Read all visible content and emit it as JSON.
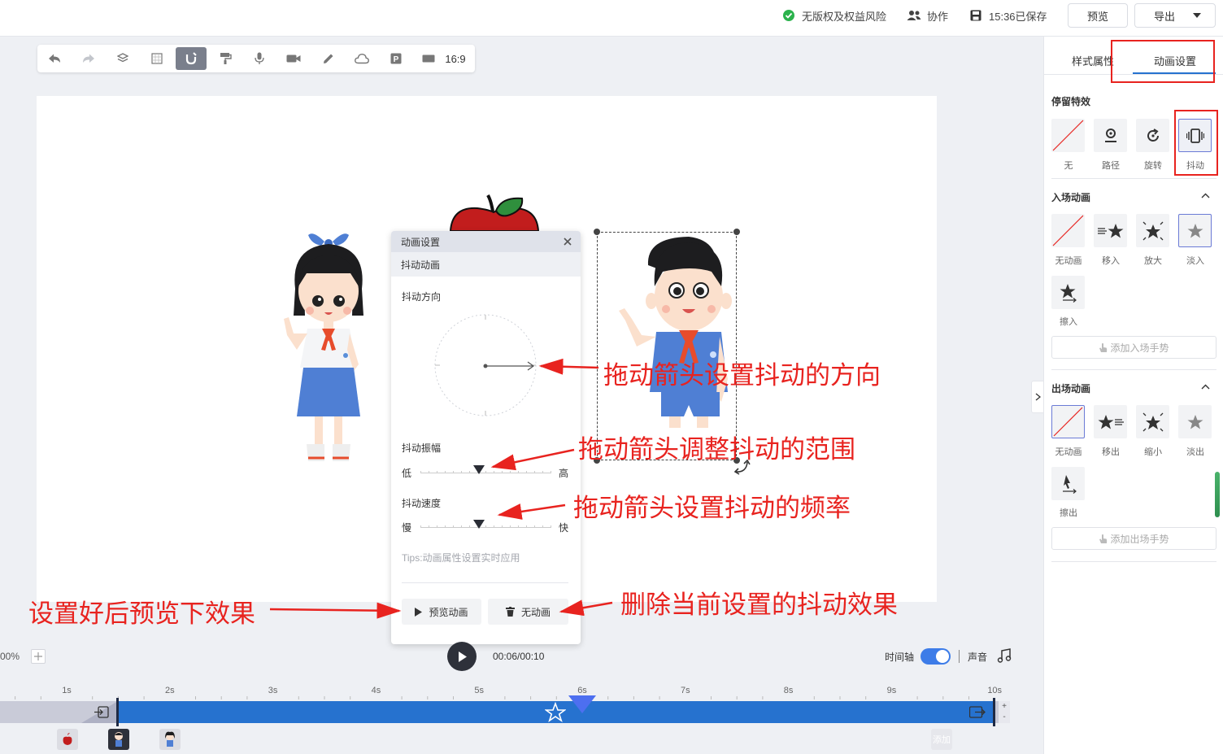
{
  "header": {
    "copyright_status": "无版权及权益风险",
    "collaborate_label": "协作",
    "saved_status": "15:36已保存",
    "preview_label": "预览",
    "export_label": "导出"
  },
  "toolbar": {
    "ratio_label": "16:9"
  },
  "dialog": {
    "title": "动画设置",
    "subtitle": "抖动动画",
    "direction_label": "抖动方向",
    "amplitude_label": "抖动振幅",
    "amp_low": "低",
    "amp_high": "高",
    "amplitude_value": 0.45,
    "speed_label": "抖动速度",
    "speed_slow": "慢",
    "speed_fast": "快",
    "speed_value": 0.45,
    "tips": "Tips:动画属性设置实时应用",
    "preview_btn": "预览动画",
    "remove_btn": "无动画"
  },
  "annotations": {
    "direction": "拖动箭头设置抖动的方向",
    "amplitude": "拖动箭头调整抖动的范围",
    "speed": "拖动箭头设置抖动的频率",
    "preview": "设置好后预览下效果",
    "remove": "删除当前设置的抖动效果"
  },
  "playbar": {
    "zoom": "00%",
    "time": "00:06/00:10",
    "timeline_label": "时间轴",
    "sound_label": "声音",
    "add_label": "添加"
  },
  "ruler": [
    "1s",
    "2s",
    "3s",
    "4s",
    "5s",
    "6s",
    "7s",
    "8s",
    "9s",
    "10s"
  ],
  "panel": {
    "tab_style": "样式属性",
    "tab_anim": "动画设置",
    "stay_title": "停留特效",
    "stay_items": [
      "无",
      "路径",
      "旋转",
      "抖动"
    ],
    "enter_title": "入场动画",
    "enter_items": [
      "无动画",
      "移入",
      "放大",
      "淡入",
      "擦入"
    ],
    "enter_gesture": "添加入场手势",
    "exit_title": "出场动画",
    "exit_items": [
      "无动画",
      "移出",
      "缩小",
      "淡出",
      "擦出"
    ],
    "exit_gesture": "添加出场手势"
  },
  "colors": {
    "accent": "#2672cf",
    "annotation": "#e8231f",
    "toggle": "#3d7ce8"
  }
}
